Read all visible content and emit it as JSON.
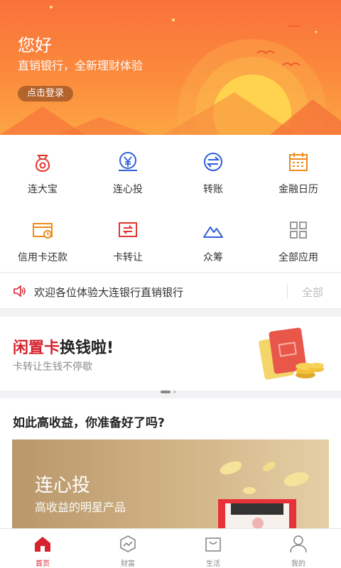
{
  "header": {
    "greeting": "您好",
    "subtitle": "直销银行，全新理财体验",
    "login_label": "点击登录"
  },
  "quick_actions": [
    {
      "label": "连大宝",
      "icon": "money-bag-icon"
    },
    {
      "label": "连心投",
      "icon": "yuan-coin-icon"
    },
    {
      "label": "转账",
      "icon": "transfer-icon"
    },
    {
      "label": "金融日历",
      "icon": "calendar-icon"
    },
    {
      "label": "信用卡还款",
      "icon": "credit-card-icon"
    },
    {
      "label": "卡转让",
      "icon": "card-transfer-icon"
    },
    {
      "label": "众筹",
      "icon": "mountain-icon"
    },
    {
      "label": "全部应用",
      "icon": "grid-apps-icon"
    }
  ],
  "notice": {
    "text": "欢迎各位体验大连银行直销银行",
    "all_label": "全部"
  },
  "promo": {
    "title_highlight": "闲置卡",
    "title_rest": "换钱啦!",
    "subtitle": "卡转让生钱不停歇"
  },
  "section": {
    "heading": "如此高收益，你准备好了吗?",
    "card_title": "连心投",
    "card_subtitle": "高收益的明星产品"
  },
  "tabbar": [
    {
      "label": "首页",
      "icon": "home-icon",
      "active": true
    },
    {
      "label": "财富",
      "icon": "wealth-icon",
      "active": false
    },
    {
      "label": "生活",
      "icon": "life-bag-icon",
      "active": false
    },
    {
      "label": "我的",
      "icon": "user-icon",
      "active": false
    }
  ],
  "colors": {
    "accent_red": "#d6232f",
    "header_orange": "#f9713a",
    "icon_blue": "#2f5fd8",
    "icon_orange": "#f08a1c"
  }
}
